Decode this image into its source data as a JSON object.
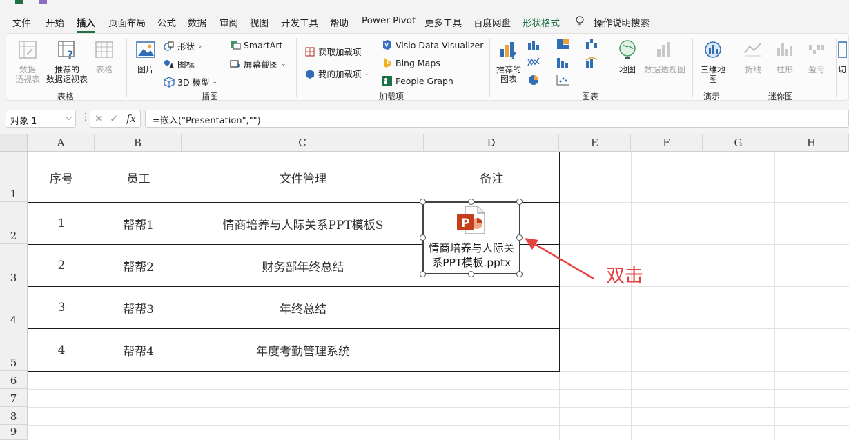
{
  "menu": {
    "tabs": [
      "文件",
      "开始",
      "插入",
      "页面布局",
      "公式",
      "数据",
      "审阅",
      "视图",
      "开发工具",
      "帮助",
      "Power Pivot",
      "更多工具",
      "百度网盘",
      "形状格式"
    ],
    "active_tab": "插入",
    "search_label": "操作说明搜索"
  },
  "ribbon": {
    "tables": {
      "pivot_label": "数据\n透视表",
      "recommended_pivot_label": "推荐的\n数据透视表",
      "table_label": "表格",
      "group_label": "表格"
    },
    "illustrations": {
      "picture_label": "图片",
      "shapes_label": "形状",
      "icons_label": "图标",
      "model3d_label": "3D 模型",
      "smartart_label": "SmartArt",
      "screenshot_label": "屏幕截图",
      "group_label": "插图"
    },
    "addins": {
      "get_addins_label": "获取加载项",
      "my_addins_label": "我的加载项",
      "visio_label": "Visio Data Visualizer",
      "bing_label": "Bing Maps",
      "people_label": "People Graph",
      "group_label": "加载项"
    },
    "charts": {
      "recommended_charts_label": "推荐的\n图表",
      "map_label": "地图",
      "pivot_chart_label": "数据透视图",
      "group_label": "图表"
    },
    "tours": {
      "map3d_label": "三维地\n图",
      "group_label": "演示"
    },
    "sparklines": {
      "line_label": "折线",
      "column_label": "柱形",
      "winloss_label": "盈亏",
      "group_label": "迷你图"
    },
    "cut_label": "切"
  },
  "formula_bar": {
    "name_box": "对象 1",
    "fx": "fx",
    "formula": "=嵌入(\"Presentation\",\"\")"
  },
  "sheet": {
    "columns": [
      "A",
      "B",
      "C",
      "D",
      "E",
      "F",
      "G",
      "H"
    ],
    "rows": [
      "1",
      "2",
      "3",
      "4",
      "5",
      "6",
      "7",
      "8",
      "9"
    ],
    "header": [
      "序号",
      "员工",
      "文件管理",
      "备注"
    ],
    "data": [
      [
        "1",
        "帮帮1",
        "情商培养与人际关系PPT模板S"
      ],
      [
        "2",
        "帮帮2",
        "财务部年终总结"
      ],
      [
        "3",
        "帮帮3",
        "年终总结"
      ],
      [
        "4",
        "帮帮4",
        "年度考勤管理系统"
      ]
    ]
  },
  "embedded_object": {
    "label": "情商培养与人际关系PPT模板.pptx",
    "icon": "powerpoint-icon"
  },
  "annotation": {
    "text": "双击",
    "color": "#e84141"
  },
  "colors": {
    "accent": "#1e7145",
    "ppt": "#c43e1c"
  }
}
